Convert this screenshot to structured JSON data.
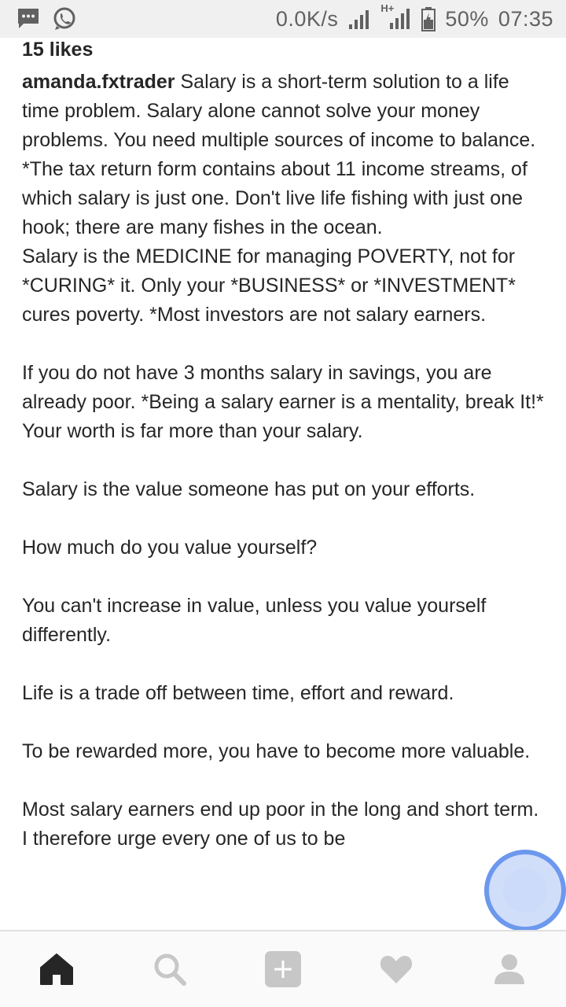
{
  "status_bar": {
    "network_speed": "0.0K/s",
    "network_type": "H+",
    "battery_percent": "50%",
    "time": "07:35",
    "left_icons": [
      "message-icon",
      "whatsapp-icon"
    ]
  },
  "post": {
    "likes": "15 likes",
    "username": "amanda.fxtrader",
    "caption_first": "Salary is a short-term solution to a life time problem. Salary alone cannot solve your money problems. You need multiple sources of income to balance. *The tax return form contains about 11 income streams, of which salary is just one. Don't live life fishing with just one hook; there are many fishes in the ocean.",
    "paragraphs": [
      "Salary is the MEDICINE for managing POVERTY, not for *CURING* it. Only your *BUSINESS* or *INVESTMENT* cures poverty. *Most investors are not salary earners.",
      "If you do not have 3 months salary in savings, you are already poor. *Being a salary earner is a mentality, break It!* Your worth is far more than your salary.",
      "Salary is the value someone has put on your efforts.",
      "How much do you value yourself?",
      "You can't increase in value, unless you value yourself differently.",
      "Life is a trade off between time, effort and reward.",
      "To be rewarded more, you have to become more valuable.",
      "Most salary earners end up poor in the long and short term. I therefore urge every one of us to be"
    ]
  },
  "bottom_nav": {
    "items": [
      "home-icon",
      "search-icon",
      "add-post-icon",
      "activity-heart-icon",
      "profile-icon"
    ],
    "active": "home-icon"
  },
  "colors": {
    "text": "#262626",
    "status_bar_bg": "#f0f0f0",
    "nav_inactive": "#c7c7c7",
    "nav_active": "#262626"
  }
}
